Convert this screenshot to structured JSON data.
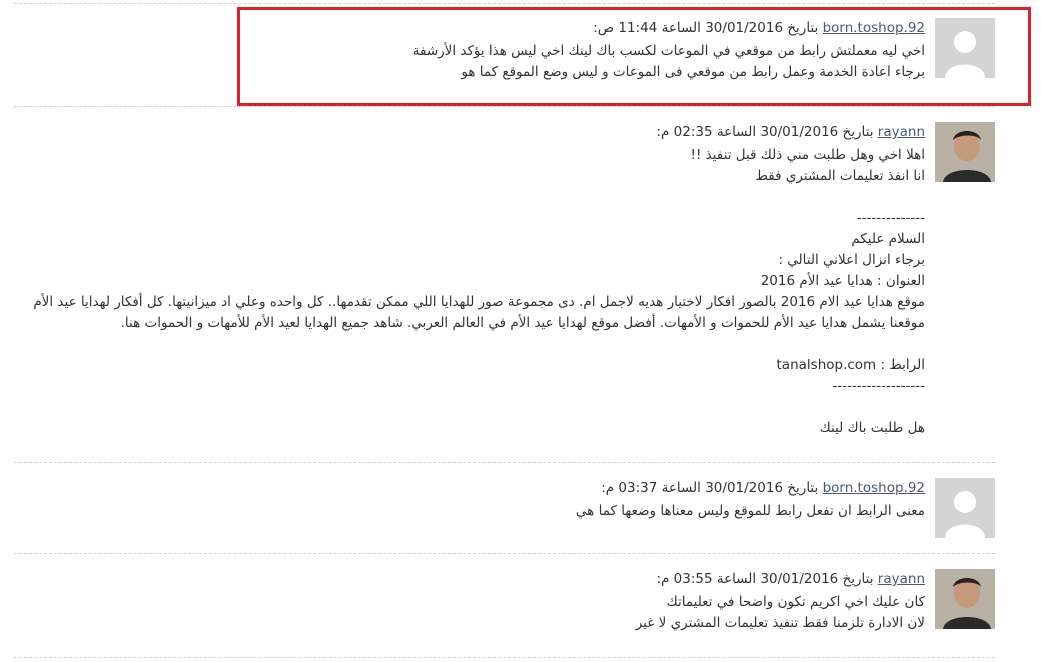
{
  "comments": [
    {
      "author": "born.toshop.92",
      "date_phrase": "بتاريخ 30/01/2016 الساعة 11:44 ص:",
      "avatar": "default-avatar",
      "lines": [
        "اخي ليه معملتش رابط من موقعي في الموعات لكسب باك لينك اخي ليس هذا يؤكد الأرشفة",
        "برجاء اعادة الخدمة وعمل رابط من موقعي فى الموعات و ليس وضع الموقع كما هو"
      ]
    },
    {
      "author": "rayann",
      "date_phrase": "بتاريخ 30/01/2016 الساعة 02:35 م:",
      "avatar": "user-photo",
      "lines": [
        "اهلا اخي وهل طلبت مني ذلك قبل تنفيذ !!",
        "انا انفذ تعليمات المشتري فقط",
        "",
        "--------------",
        "السلام عليكم",
        "برجاء انزال اعلاني التالي :",
        "العنوان : هدايا عيد الأم 2016",
        "موقع هدايا عيد الام 2016 بالصور افكار لاختيار هديه لاجمل ام. دى مجموعة صور للهدايا اللي ممكن تقدمها.. كل واحده وعلي اد ميزانيتها. كل أفكار لهدايا عيد الأم",
        "موقعنا يشمل هدايا عيد الأم للحموات و الأمهات. أفضل موقع لهدايا عيد الأم في العالم العربي. شاهد جميع الهدايا لعيد الأم للأمهات و الحموات هنا.",
        "",
        "الرابط : tanalshop.com",
        "-------------------",
        "",
        "هل طلبت باك لينك"
      ]
    },
    {
      "author": "born.toshop.92",
      "date_phrase": "بتاريخ 30/01/2016 الساعة 03:37 م:",
      "avatar": "default-avatar",
      "lines": [
        "معنى الرابط ان تفعل رابط للموقع وليس معناها وضعها كما هي"
      ]
    },
    {
      "author": "rayann",
      "date_phrase": "بتاريخ 30/01/2016 الساعة 03:55 م:",
      "avatar": "user-photo",
      "lines": [
        "كان عليك اخي اكريم تكون واضحا في تعليماتك",
        "لان الادارة تلزمنا فقط تنفيذ تعليمات المشتري لا غير"
      ]
    }
  ],
  "highlight_color": "#d9222c",
  "link_color": "#4a5a7a"
}
